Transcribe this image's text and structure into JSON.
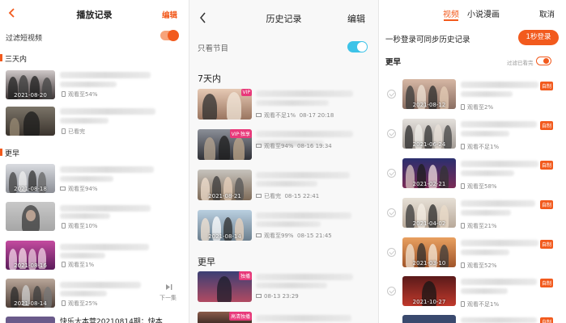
{
  "panel1": {
    "back_icon": "chevron-left-icon",
    "title": "播放记录",
    "edit_label": "编辑",
    "filter_label": "过滤短视频",
    "filter_on": true,
    "section_recent": "三天内",
    "section_older": "更早",
    "accent": "#f25a1d",
    "items": [
      {
        "date": "2021-08-20",
        "progress": "观看至54%"
      },
      {
        "date": "",
        "progress": "已看完"
      },
      {
        "date": "2021-08-18",
        "progress": "观看至94%"
      },
      {
        "date": "",
        "progress": "观看至10%"
      },
      {
        "date": "2021-08-16",
        "progress": "观看至1%"
      },
      {
        "date": "2021-08-14",
        "progress": "观看至25%"
      }
    ],
    "next_label": "下一集",
    "bottom_title": "快乐大本营20210814期：快本"
  },
  "panel2": {
    "back_icon": "chevron-left-icon",
    "title": "历史记录",
    "edit_label": "编辑",
    "filter_label": "只看节目",
    "filter_on": true,
    "section_recent": "7天内",
    "section_older": "更早",
    "accent": "#3dc3e8",
    "items": [
      {
        "tag": "VIP",
        "progress": "观看不足1%",
        "time": "08-17 20:18"
      },
      {
        "tag": "VIP·独享",
        "progress": "观看至94%",
        "time": "08-16 19:34"
      },
      {
        "tag": "",
        "date": "2021-08-21",
        "progress": "已看完",
        "time": "08-15 22:41"
      },
      {
        "tag": "",
        "date": "2021-08-14",
        "progress": "观看至99%",
        "time": "08-15 21:45"
      },
      {
        "tag": "独播",
        "progress": "",
        "time": "08-13 23:29"
      },
      {
        "tag": "高清独播",
        "progress": "",
        "time": ""
      }
    ]
  },
  "panel3": {
    "tab_video": "视频",
    "tab_novel": "小说漫画",
    "cancel_label": "取消",
    "login_prompt": "一秒登录可同步历史记录",
    "login_button": "1秒登录",
    "section_older": "更早",
    "filter_label": "过滤已看完",
    "filter_on": true,
    "accent": "#f25a1d",
    "self_made": "自制",
    "items": [
      {
        "date": "2021-08-12",
        "progress": "观看至2%"
      },
      {
        "date": "2021-06-24",
        "progress": "观看不足1%"
      },
      {
        "date": "2021-02-21",
        "progress": "观看至58%"
      },
      {
        "date": "2021-04-02",
        "progress": "观看至21%"
      },
      {
        "date": "2021-03-10",
        "progress": "观看至52%"
      },
      {
        "date": "2021-10-27",
        "progress": "观看不足1%"
      },
      {
        "date": "",
        "progress": ""
      }
    ]
  }
}
